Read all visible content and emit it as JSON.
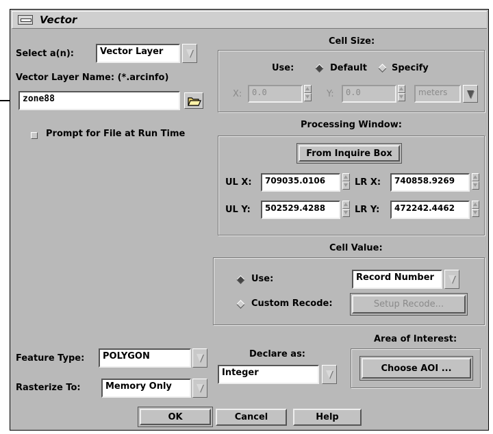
{
  "window": {
    "title": "Vector"
  },
  "left": {
    "select_label": "Select a(n):",
    "select_value": "Vector Layer",
    "layer_name_label": "Vector Layer Name: (*.arcinfo)",
    "layer_name_value": "zone88",
    "prompt_label": "Prompt for File at Run Time",
    "feature_type_label": "Feature Type:",
    "feature_type_value": "POLYGON",
    "rasterize_label": "Rasterize To:",
    "rasterize_value": "Memory Only"
  },
  "cell_size": {
    "title": "Cell Size:",
    "use_label": "Use:",
    "option_default": "Default",
    "option_specify": "Specify",
    "selected": "Default",
    "x_label": "X:",
    "x_value": "0.0",
    "y_label": "Y:",
    "y_value": "0.0",
    "units": "meters"
  },
  "processing_window": {
    "title": "Processing Window:",
    "inquire_button": "From Inquire Box",
    "ulx_label": "UL X:",
    "ulx_value": "709035.0106",
    "lrx_label": "LR X:",
    "lrx_value": "740858.9269",
    "uly_label": "UL Y:",
    "uly_value": "502529.4288",
    "lry_label": "LR Y:",
    "lry_value": "472242.4462"
  },
  "cell_value": {
    "title": "Cell Value:",
    "use_label": "Use:",
    "use_value": "Record Number",
    "custom_label": "Custom Recode:",
    "setup_button": "Setup Recode...",
    "selected": "Use"
  },
  "declare": {
    "label": "Declare as:",
    "value": "Integer"
  },
  "aoi": {
    "label": "Area of Interest:",
    "button": "Choose AOI ..."
  },
  "footer": {
    "ok": "OK",
    "cancel": "Cancel",
    "help": "Help"
  },
  "colors": {
    "background": "#b9b9b9",
    "field": "#ffffff",
    "disabled_text": "#8a8a8a"
  }
}
